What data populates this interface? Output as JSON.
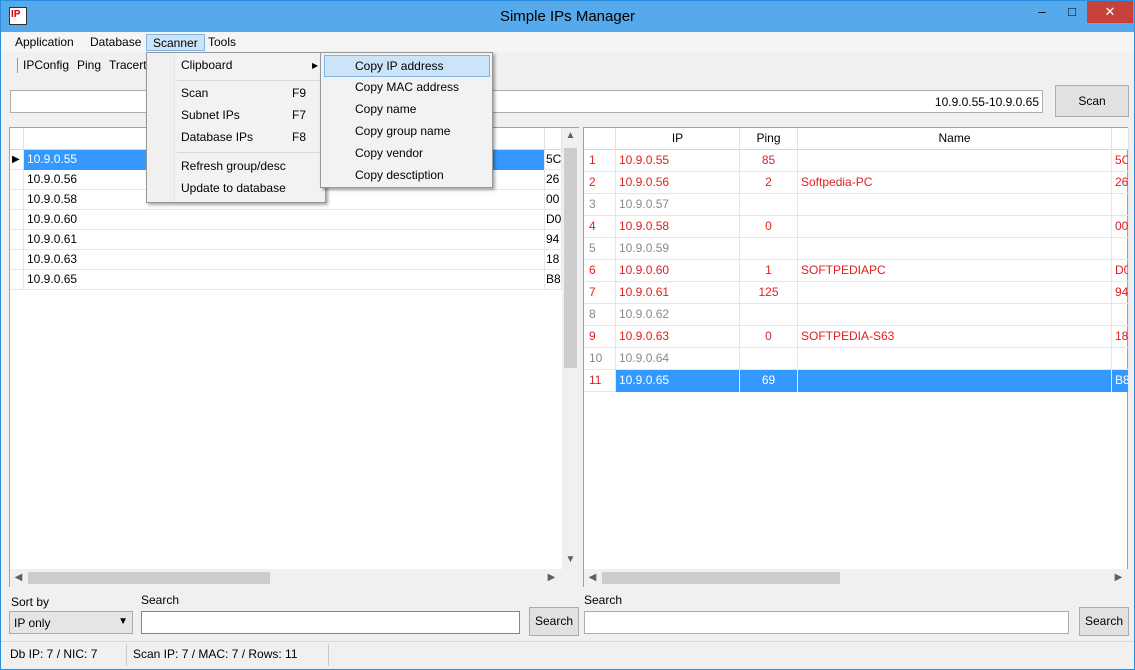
{
  "window": {
    "title": "Simple IPs Manager",
    "minimize": "–",
    "maximize": "□",
    "close": "✕"
  },
  "menubar": [
    "Application",
    "Database",
    "Scanner",
    "Tools"
  ],
  "toolbar": [
    "IPConfig",
    "Ping",
    "Tracert"
  ],
  "range": {
    "value": "10.9.0.55-10.9.0.65",
    "scan_label": "Scan"
  },
  "scanner_menu": {
    "items": [
      {
        "label": "Clipboard",
        "shortcut": ""
      },
      {
        "label": "Scan",
        "shortcut": "F9"
      },
      {
        "label": "Subnet IPs",
        "shortcut": "F7"
      },
      {
        "label": "Database IPs",
        "shortcut": "F8"
      },
      {
        "label": "Refresh group/desc",
        "shortcut": ""
      },
      {
        "label": "Update to database",
        "shortcut": ""
      }
    ],
    "submenu_arrow": "▶"
  },
  "clipboard_submenu": [
    "Copy IP address",
    "Copy MAC address",
    "Copy name",
    "Copy group name",
    "Copy vendor",
    "Copy desctiption"
  ],
  "left_table": {
    "rows": [
      {
        "ip": "10.9.0.55",
        "mac": "5C"
      },
      {
        "ip": "10.9.0.56",
        "mac": "26"
      },
      {
        "ip": "10.9.0.58",
        "mac": "00"
      },
      {
        "ip": "10.9.0.60",
        "mac": "D0"
      },
      {
        "ip": "10.9.0.61",
        "mac": "94"
      },
      {
        "ip": "10.9.0.63",
        "mac": "18"
      },
      {
        "ip": "10.9.0.65",
        "mac": "B8"
      }
    ]
  },
  "right_table": {
    "headers": {
      "ip": "IP",
      "ping": "Ping",
      "name": "Name"
    },
    "rows": [
      {
        "n": "1",
        "ip": "10.9.0.55",
        "ping": "85",
        "name": "",
        "mac": "5C"
      },
      {
        "n": "2",
        "ip": "10.9.0.56",
        "ping": "2",
        "name": "Softpedia-PC",
        "mac": "26"
      },
      {
        "n": "3",
        "ip": "10.9.0.57",
        "ping": "",
        "name": "",
        "mac": ""
      },
      {
        "n": "4",
        "ip": "10.9.0.58",
        "ping": "0",
        "name": "",
        "mac": "00"
      },
      {
        "n": "5",
        "ip": "10.9.0.59",
        "ping": "",
        "name": "",
        "mac": ""
      },
      {
        "n": "6",
        "ip": "10.9.0.60",
        "ping": "1",
        "name": "SOFTPEDIAPC",
        "mac": "D0"
      },
      {
        "n": "7",
        "ip": "10.9.0.61",
        "ping": "125",
        "name": "",
        "mac": "94"
      },
      {
        "n": "8",
        "ip": "10.9.0.62",
        "ping": "",
        "name": "",
        "mac": ""
      },
      {
        "n": "9",
        "ip": "10.9.0.63",
        "ping": "0",
        "name": "SOFTPEDIA-S63",
        "mac": "18"
      },
      {
        "n": "10",
        "ip": "10.9.0.64",
        "ping": "",
        "name": "",
        "mac": ""
      },
      {
        "n": "11",
        "ip": "10.9.0.65",
        "ping": "69",
        "name": "",
        "mac": "B8"
      }
    ]
  },
  "bottom_left": {
    "sort_label": "Sort by",
    "sort_value": "IP only",
    "search_label": "Search",
    "search_button": "Search"
  },
  "bottom_right": {
    "search_label": "Search",
    "search_button": "Search"
  },
  "status": {
    "db": "Db IP: 7 / NIC: 7",
    "scan": "Scan IP: 7 / MAC: 7 / Rows: 11"
  },
  "colors": {
    "accent": "#3399ff",
    "online_text": "#e02020",
    "offline_text": "#8a8a8a"
  }
}
